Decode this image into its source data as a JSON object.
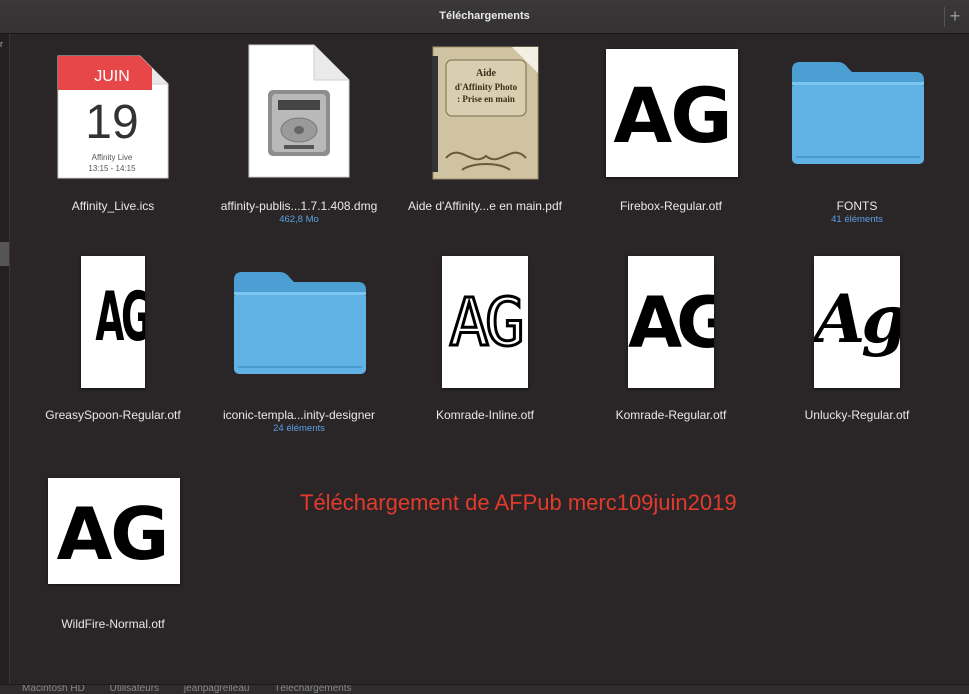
{
  "window": {
    "title": "Téléchargements"
  },
  "left_strip": {
    "char": "r"
  },
  "items": [
    {
      "name": "Affinity_Live.ics",
      "cal_month": "JUIN",
      "cal_day": "19",
      "cal_event": "Affinity Live",
      "cal_time": "13:15 - 14:15"
    },
    {
      "name": "affinity-publis...1.7.1.408.dmg",
      "info": "462,8 Mo"
    },
    {
      "name": "Aide d'Affinity...e en main.pdf",
      "cover_line1": "Aide",
      "cover_line2": "d'Affinity Photo",
      "cover_line3": ": Prise en main"
    },
    {
      "name": "Firebox-Regular.otf",
      "glyphs": "AG"
    },
    {
      "name": "FONTS",
      "info": "41 éléments"
    },
    {
      "name": "GreasySpoon-Regular.otf",
      "glyphs": "AG"
    },
    {
      "name": "iconic-templa...inity-designer",
      "info": "24 éléments"
    },
    {
      "name": "Komrade-Inline.otf",
      "glyphs": "AG"
    },
    {
      "name": "Komrade-Regular.otf",
      "glyphs": "AG"
    },
    {
      "name": "Unlucky-Regular.otf",
      "glyphs": "Ag"
    },
    {
      "name": "WildFire-Normal.otf",
      "glyphs": "AG"
    }
  ],
  "annotation": "Téléchargement de AFPub merc109juin2019",
  "path_bar": [
    "Macintosh HD",
    "Utilisateurs",
    "jeanpagrelleau",
    "Téléchargements"
  ],
  "colors": {
    "folder": "#5fb2e3",
    "annotation": "#e23a2c",
    "sublabel": "#5aa0e6",
    "calendar_header": "#e8474a"
  }
}
